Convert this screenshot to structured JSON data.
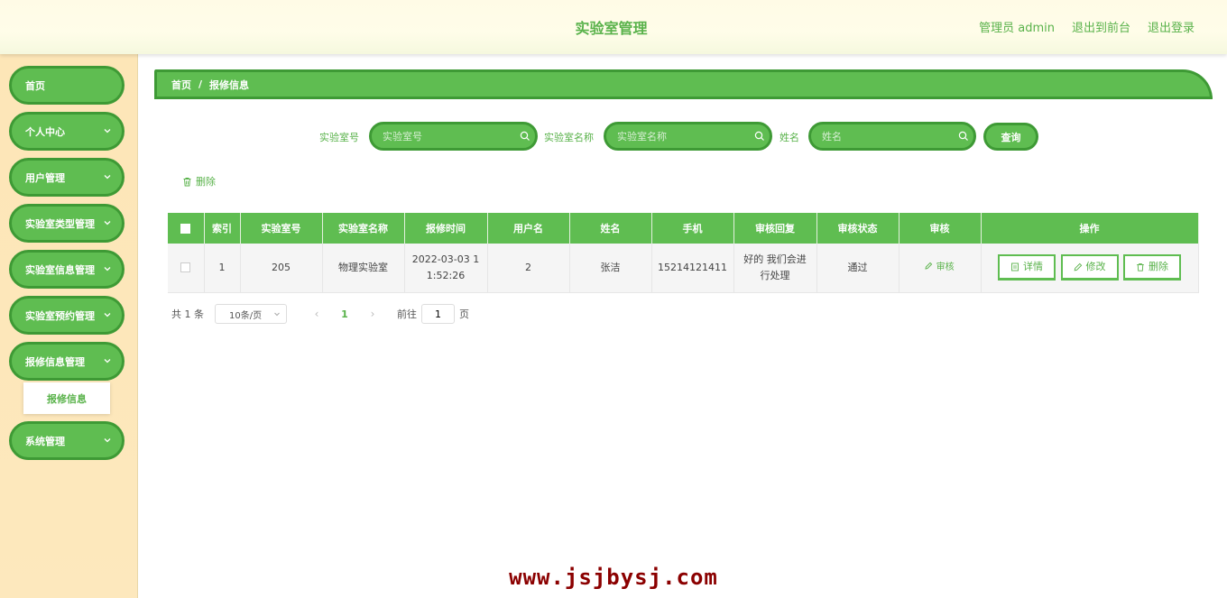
{
  "header": {
    "title": "实验室管理",
    "links": [
      "管理员 admin",
      "退出到前台",
      "退出登录"
    ]
  },
  "sidebar": {
    "items": [
      {
        "label": "首页",
        "has_chevron": false
      },
      {
        "label": "个人中心",
        "has_chevron": true
      },
      {
        "label": "用户管理",
        "has_chevron": true
      },
      {
        "label": "实验室类型管理",
        "has_chevron": true
      },
      {
        "label": "实验室信息管理",
        "has_chevron": true
      },
      {
        "label": "实验室预约管理",
        "has_chevron": true
      },
      {
        "label": "报修信息管理",
        "has_chevron": true
      },
      {
        "label": "系统管理",
        "has_chevron": true
      }
    ],
    "submenu_label": "报修信息"
  },
  "breadcrumb": {
    "home": "首页",
    "sep": "/",
    "current": "报修信息"
  },
  "search": {
    "lab_no_label": "实验室号",
    "lab_no_placeholder": "实验室号",
    "lab_name_label": "实验室名称",
    "lab_name_placeholder": "实验室名称",
    "name_label": "姓名",
    "name_placeholder": "姓名",
    "query_label": "查询"
  },
  "toolbar": {
    "delete_label": "删除"
  },
  "table": {
    "headers": [
      "索引",
      "实验室号",
      "实验室名称",
      "报修时间",
      "用户名",
      "姓名",
      "手机",
      "审核回复",
      "审核状态",
      "审核",
      "操作"
    ],
    "rows": [
      {
        "index": "1",
        "lab_no": "205",
        "lab_name": "物理实验室",
        "time": "2022-03-03 11:52:26",
        "username": "2",
        "name": "张洁",
        "phone": "15214121411",
        "reply": "好的 我们会进行处理",
        "status": "通过",
        "audit": "审核",
        "detail": "详情",
        "edit": "修改",
        "delete": "删除"
      }
    ]
  },
  "pager": {
    "total": "共 1 条",
    "size": "10条/页",
    "page": "1",
    "goto_prefix": "前往",
    "goto_value": "1",
    "goto_suffix": "页"
  },
  "watermark": "www.jsjbysj.com",
  "colors": {
    "accent": "#5fbd51",
    "accent_border": "#3e9a35",
    "sidebar_bg": "#fde6b7",
    "watermark": "#8b0000"
  }
}
